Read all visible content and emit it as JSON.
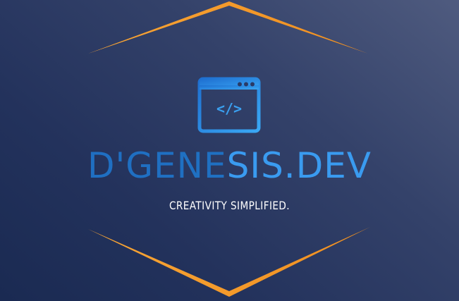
{
  "brand": {
    "name_part1": "D'GENE",
    "name_part2": "SIS.DEV",
    "tagline": "CREATIVITY SIMPLIFIED."
  },
  "icons": {
    "logo": "browser-window-code-icon",
    "code_glyph": "</>"
  },
  "colors": {
    "background_dark": "#1a2a52",
    "background_light": "#4f5b7f",
    "accent_orange": "#f5a030",
    "brand_blue_dark": "#1f73c8",
    "brand_blue_light": "#3a9bf0",
    "tagline": "#ffffff"
  }
}
